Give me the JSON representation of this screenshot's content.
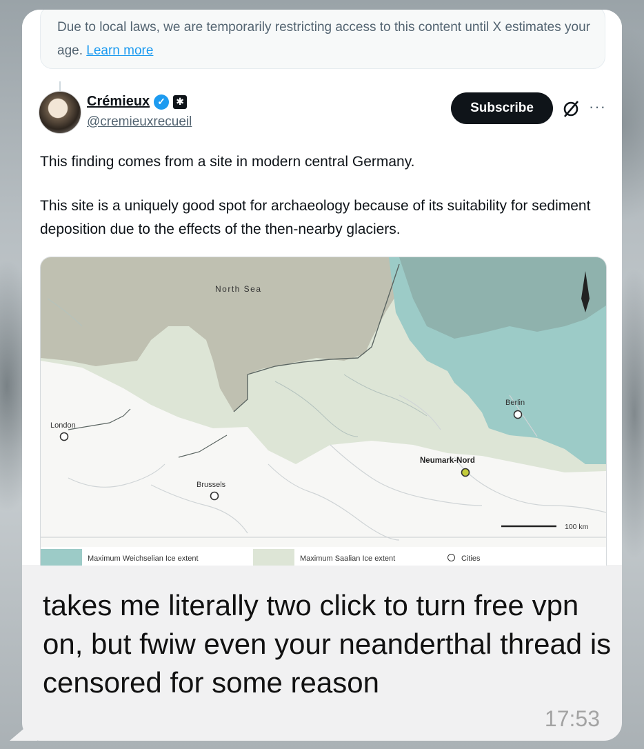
{
  "notice": {
    "text": "Due to local laws, we are temporarily restricting access to this content until X estimates your age.",
    "link": "Learn more"
  },
  "tweet": {
    "author_name": "Crémieux",
    "author_handle": "@cremieuxrecueil",
    "subscribe_label": "Subscribe",
    "more_label": "···",
    "paragraph_1": "This finding comes from a site in modern central Germany.",
    "paragraph_2": "This site is a uniquely good spot for archaeology because of its suitability for sediment deposition due to the effects of the then-nearby glaciers."
  },
  "map": {
    "labels": {
      "sea": "North Sea",
      "london": "London",
      "brussels": "Brussels",
      "berlin": "Berlin",
      "site": "Neumark-Nord",
      "scale": "100 km"
    },
    "legend": {
      "weichselian": "Maximum Weichselian Ice extent",
      "saalian": "Maximum Saalian Ice extent",
      "cities": "Cities"
    },
    "colors": {
      "sea": "#bfc0b1",
      "weichselian": "#9ccbc7",
      "saalian": "#dde5d6",
      "land": "#f7f7f5",
      "site_marker": "#c3cc3a"
    }
  },
  "message": {
    "text": "takes me literally two click to turn free vpn on, but fwiw even your neanderthal thread is censored for some reason",
    "time": "17:53"
  }
}
